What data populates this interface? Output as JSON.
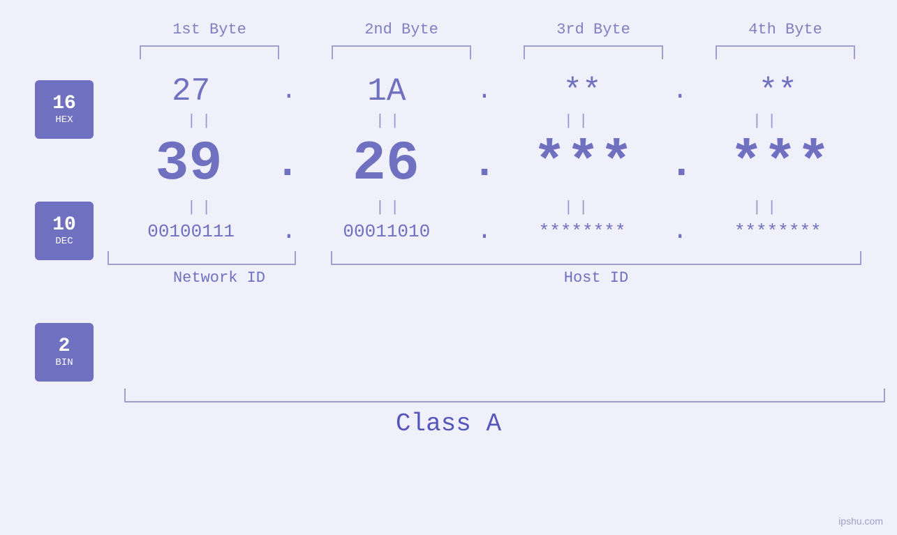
{
  "byteLabels": [
    "1st Byte",
    "2nd Byte",
    "3rd Byte",
    "4th Byte"
  ],
  "badges": [
    {
      "number": "16",
      "label": "HEX"
    },
    {
      "number": "10",
      "label": "DEC"
    },
    {
      "number": "2",
      "label": "BIN"
    }
  ],
  "hexValues": [
    "27",
    "1A",
    "**",
    "**"
  ],
  "decValues": [
    "39",
    "26",
    "***",
    "***"
  ],
  "binValues": [
    "00100111",
    "00011010",
    "********",
    "********"
  ],
  "networkId": "Network ID",
  "hostId": "Host ID",
  "classLabel": "Class A",
  "watermark": "ipshu.com",
  "equalsSign": "||",
  "dotSep": "."
}
